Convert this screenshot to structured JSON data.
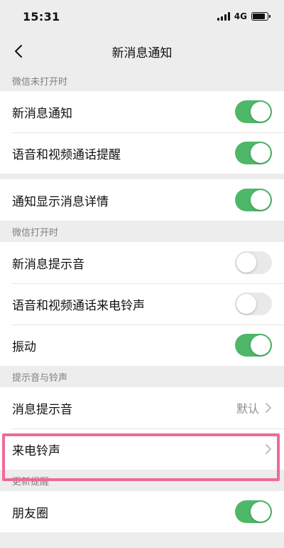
{
  "status_bar": {
    "time": "15:31",
    "network": "4G"
  },
  "nav": {
    "title": "新消息通知",
    "back_icon": "chevron-left-icon"
  },
  "sections": {
    "wechat_closed": "微信未打开时",
    "wechat_open": "微信打开时",
    "sound_ringtone": "提示音与铃声",
    "updates": "更新提醒"
  },
  "rows": {
    "new_message": {
      "label": "新消息通知",
      "enabled": true
    },
    "voice_video_reminder": {
      "label": "语音和视频通话提醒",
      "enabled": true
    },
    "show_details": {
      "label": "通知显示消息详情",
      "enabled": true
    },
    "new_message_sound": {
      "label": "新消息提示音",
      "enabled": false
    },
    "call_ringtone_toggle": {
      "label": "语音和视频通话来电铃声",
      "enabled": false
    },
    "vibrate": {
      "label": "振动",
      "enabled": true
    },
    "message_sound": {
      "label": "消息提示音",
      "value": "默认"
    },
    "incoming_ringtone": {
      "label": "来电铃声"
    },
    "moments": {
      "label": "朋友圈",
      "enabled": true
    }
  },
  "colors": {
    "toggle_on": "#4EB868",
    "toggle_off": "#E9E9EA",
    "highlight": "#EE6A96",
    "background": "#EDEDED"
  }
}
